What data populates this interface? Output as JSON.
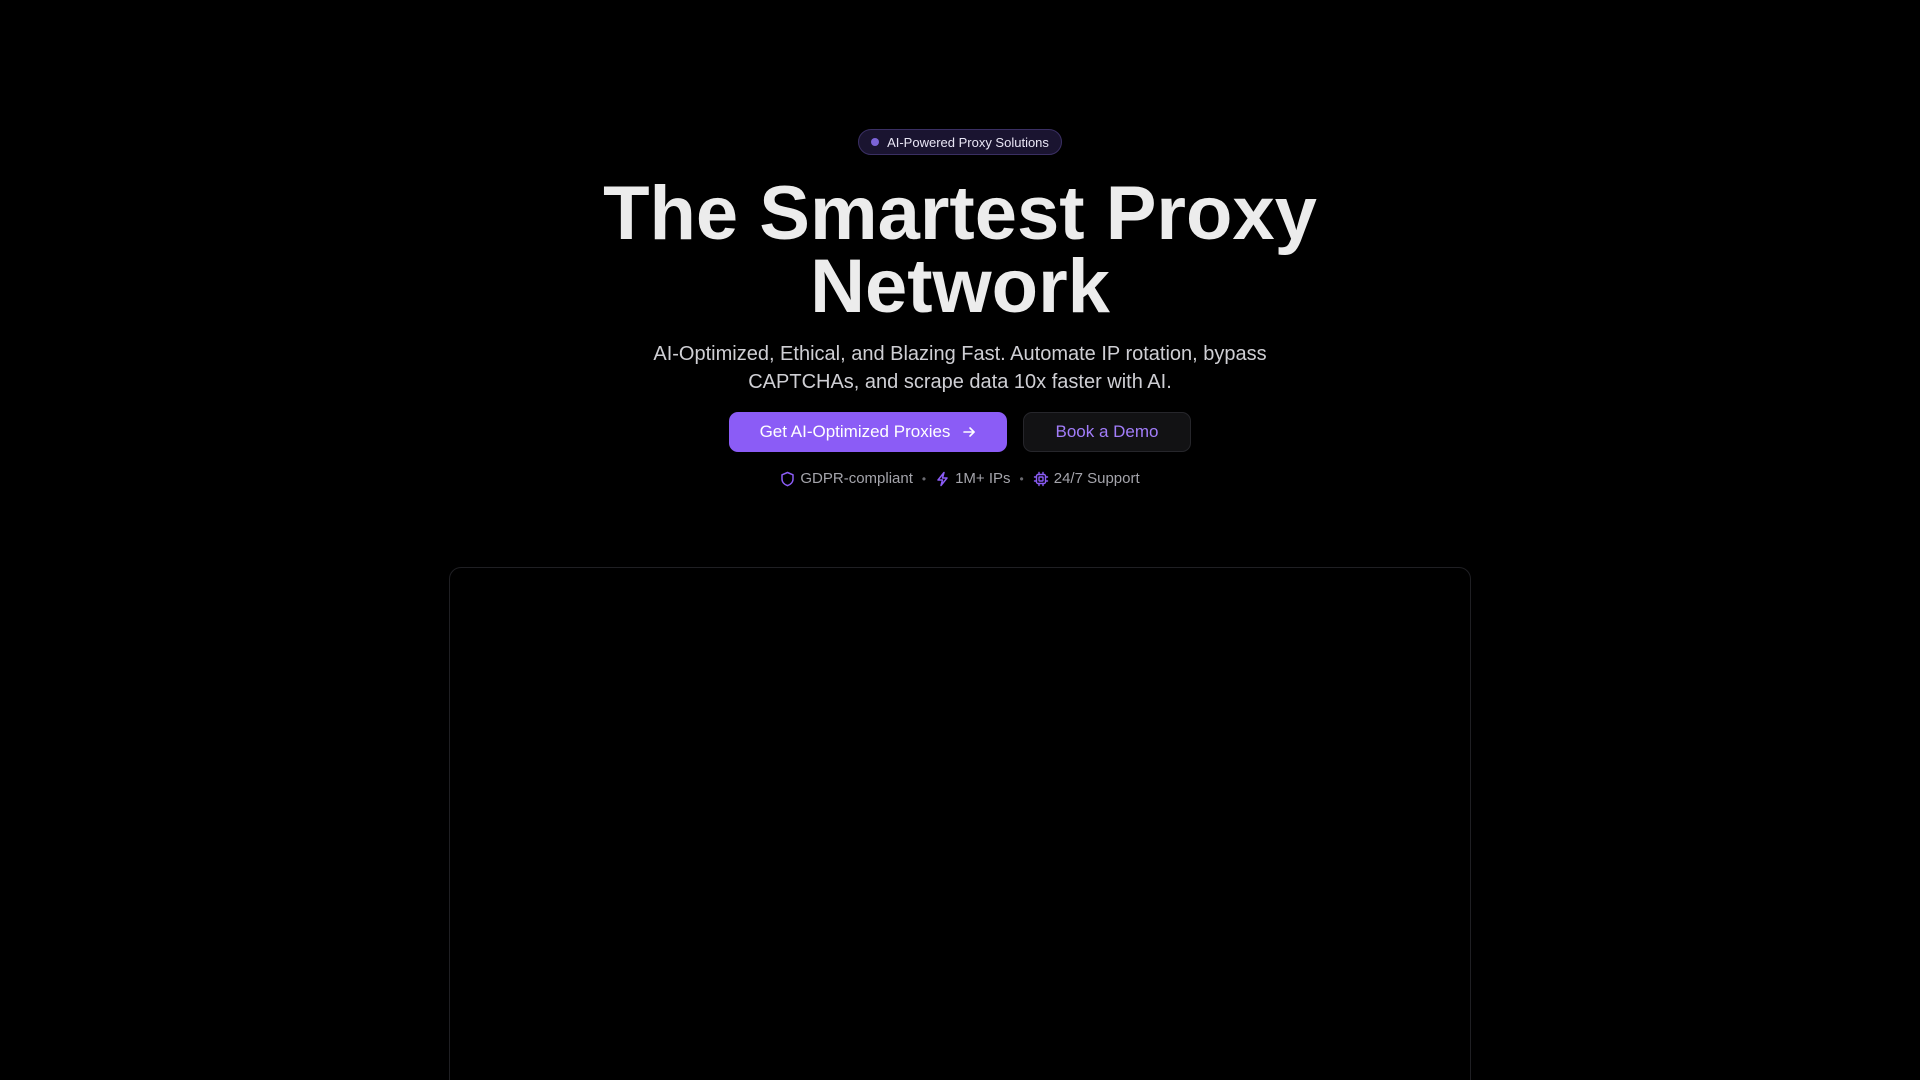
{
  "hero": {
    "badge_label": "AI-Powered Proxy Solutions",
    "title": "The Smartest Proxy Network",
    "subtitle": "AI-Optimized, Ethical, and Blazing Fast. Automate IP rotation, bypass CAPTCHAs, and scrape data 10x faster with AI.",
    "primary_cta": "Get AI-Optimized Proxies",
    "secondary_cta": "Book a Demo",
    "features": [
      {
        "label": "GDPR-compliant",
        "icon": "shield-icon"
      },
      {
        "label": "1M+ IPs",
        "icon": "lightning-icon"
      },
      {
        "label": "24/7 Support",
        "icon": "chip-icon"
      }
    ],
    "separator": "•"
  },
  "colors": {
    "background": "#000000",
    "accent": "#8b5cf6",
    "accent_text": "#a27dfa",
    "badge_dot": "#7b63d6"
  }
}
